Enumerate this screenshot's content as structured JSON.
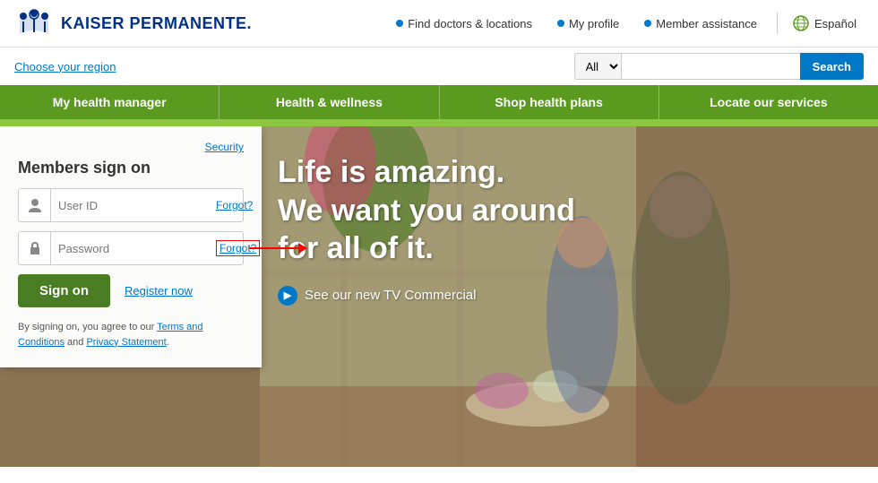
{
  "header": {
    "logo_text": "KAISER PERMANENTE.",
    "links": [
      {
        "label": "Find doctors & locations"
      },
      {
        "label": "My profile"
      },
      {
        "label": "Member assistance"
      }
    ],
    "espanol": "Español"
  },
  "subheader": {
    "choose_region": "Choose your region",
    "search_placeholder": "",
    "search_all_label": "All",
    "search_button_label": "Search"
  },
  "nav": {
    "items": [
      {
        "label": "My health manager"
      },
      {
        "label": "Health & wellness"
      },
      {
        "label": "Shop health plans"
      },
      {
        "label": "Locate our services"
      }
    ]
  },
  "hero": {
    "headline_line1": "Life is amazing.",
    "headline_line2": "We want you around",
    "headline_line3": "for all of it.",
    "cta_text": "See our new TV Commercial"
  },
  "signin": {
    "security_label": "Security",
    "title": "Members sign on",
    "userid_placeholder": "User ID",
    "userid_forgot": "Forgot?",
    "password_placeholder": "Password",
    "password_forgot": "Forgot?",
    "signin_button": "Sign on",
    "register_link": "Register now",
    "terms_prefix": "By signing on, you agree to our",
    "terms_link": "Terms and Conditions",
    "terms_and": "and",
    "privacy_link": "Privacy Statement",
    "terms_suffix": "."
  }
}
